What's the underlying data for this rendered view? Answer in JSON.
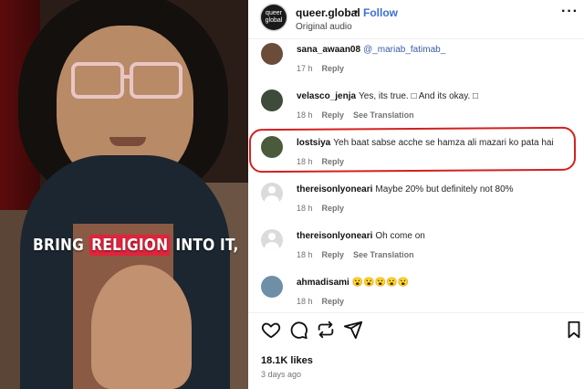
{
  "video": {
    "caption_before": "BRING",
    "caption_highlight": "RELIGION",
    "caption_after": "INTO IT,"
  },
  "post": {
    "avatar_text_1": "queer",
    "avatar_text_2": "global",
    "username": "queer.global",
    "separator": "•",
    "follow_label": "Follow",
    "audio": "Original audio",
    "more_icon": "more-icon"
  },
  "comments": [
    {
      "username": "sana_awaan08",
      "mention": "@_mariab_fatimab_",
      "text": "",
      "time": "17 h",
      "reply": "Reply",
      "translation": "",
      "avatar_color": "#6b4b3a"
    },
    {
      "username": "velasco_jenja",
      "mention": "",
      "text": "Yes, its true. □ And its okay. □",
      "time": "18 h",
      "reply": "Reply",
      "translation": "See Translation",
      "avatar_color": "#3e4a3a"
    },
    {
      "username": "lostsiya",
      "mention": "",
      "text": "Yeh baat sabse acche se hamza ali mazari ko pata hai",
      "time": "18 h",
      "reply": "Reply",
      "translation": "",
      "avatar_color": "#4a5a3a"
    },
    {
      "username": "thereisonlyoneari",
      "mention": "",
      "text": "Maybe 20% but definitely not 80%",
      "time": "18 h",
      "reply": "Reply",
      "translation": "",
      "avatar_color": "default"
    },
    {
      "username": "thereisonlyoneari",
      "mention": "",
      "text": "Oh come on",
      "time": "18 h",
      "reply": "Reply",
      "translation": "See Translation",
      "avatar_color": "default"
    },
    {
      "username": "ahmadisami",
      "mention": "",
      "text": "😮😮😮😮😮",
      "time": "18 h",
      "reply": "Reply",
      "translation": "",
      "avatar_color": "#6f8fa8"
    }
  ],
  "actions": {
    "like_icon": "heart-icon",
    "comment_icon": "comment-icon",
    "repost_icon": "repost-icon",
    "share_icon": "share-icon",
    "save_icon": "bookmark-icon"
  },
  "likes": "18.1K likes",
  "date": "3 days ago",
  "colors": {
    "link_blue": "#3b6fd8",
    "annotation_red": "#d32020",
    "caption_highlight": "#e0243c"
  }
}
